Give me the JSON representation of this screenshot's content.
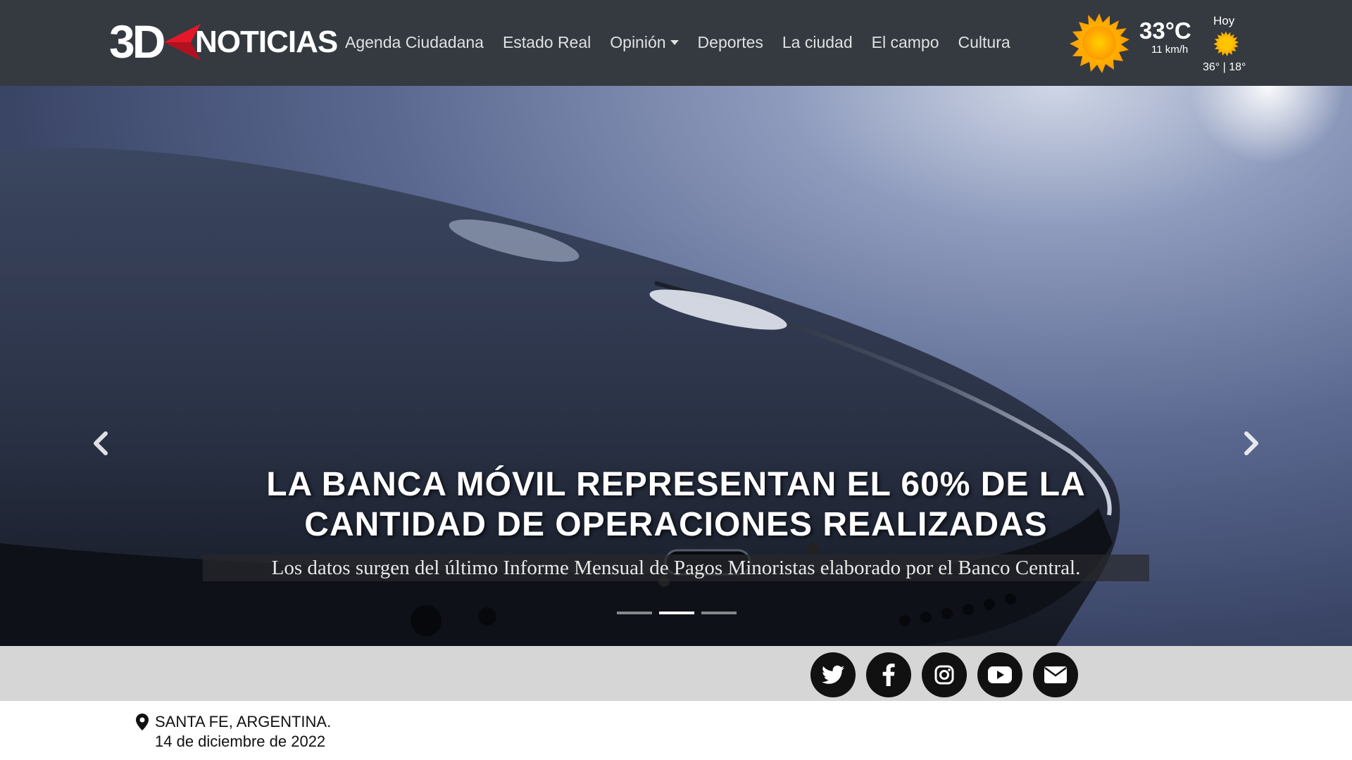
{
  "brand": {
    "logo_part1": "3D",
    "logo_part2": "NOTICIAS",
    "accent_color": "#e3192a"
  },
  "nav": {
    "items": [
      {
        "label": "Agenda Ciudadana"
      },
      {
        "label": "Estado Real"
      },
      {
        "label": "Opinión",
        "has_dropdown": true
      },
      {
        "label": "Deportes"
      },
      {
        "label": "La ciudad"
      },
      {
        "label": "El campo"
      },
      {
        "label": "Cultura"
      }
    ]
  },
  "weather": {
    "icon": "sun-icon",
    "temperature": "33°C",
    "wind": "11 km/h",
    "today_label": "Hoy",
    "today_icon": "sun-icon",
    "today_range": "36° | 18°"
  },
  "hero": {
    "title": "LA BANCA MÓVIL REPRESENTAN EL 60% DE LA CANTIDAD DE OPERACIONES REALIZADAS",
    "subtitle": "Los datos surgen del último Informe Mensual de Pagos Minoristas elaborado por el Banco Central.",
    "prev_icon": "chevron-left-icon",
    "next_icon": "chevron-right-icon",
    "slides_count": 3,
    "active_slide": 2
  },
  "social": {
    "bar_color": "#d6d6d6",
    "icons": [
      "twitter-icon",
      "facebook-icon",
      "instagram-icon",
      "youtube-icon",
      "envelope-icon"
    ]
  },
  "location": {
    "icon": "map-pin-icon",
    "place": "SANTA FE, ARGENTINA.",
    "date": "14 de diciembre de 2022"
  }
}
